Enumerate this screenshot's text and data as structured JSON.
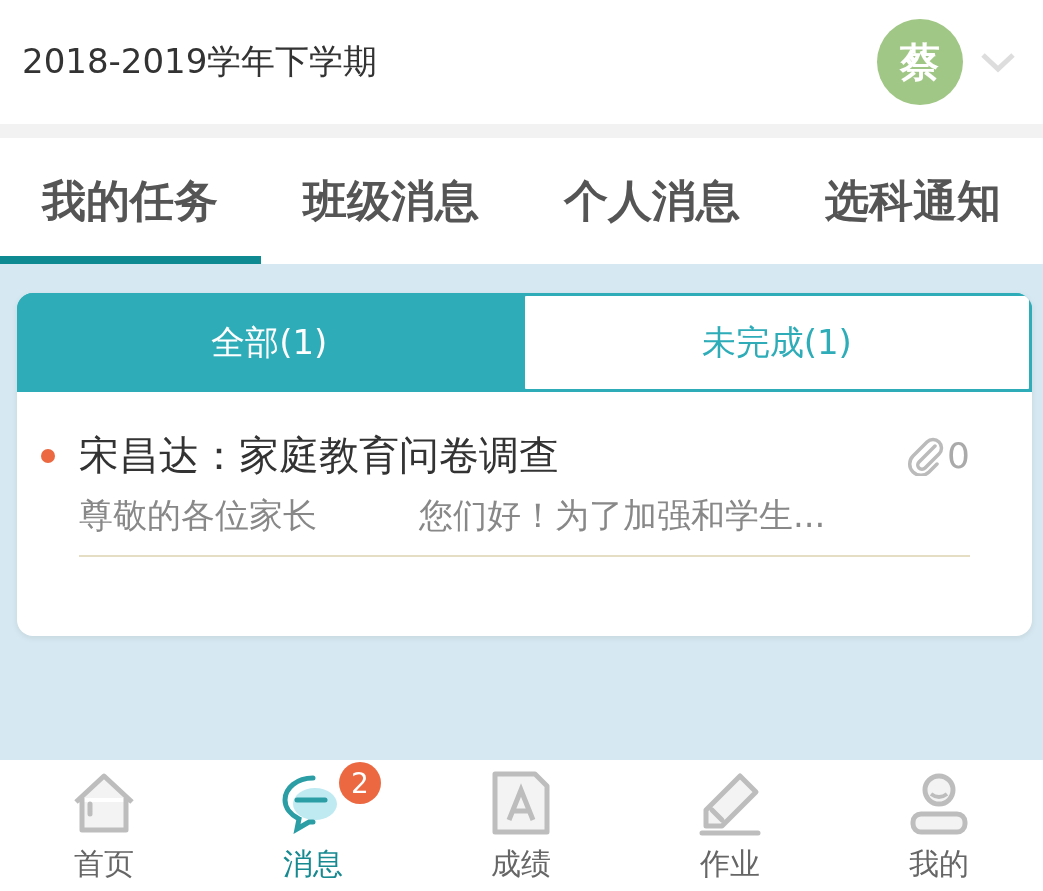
{
  "header": {
    "term": "2018-2019学年下学期",
    "avatar": "蔡"
  },
  "tabs": [
    {
      "label": "我的任务",
      "selected": true
    },
    {
      "label": "班级消息",
      "selected": false
    },
    {
      "label": "个人消息",
      "selected": false
    },
    {
      "label": "选科通知",
      "selected": false
    }
  ],
  "filters": [
    {
      "label": "全部(1)",
      "selected": true
    },
    {
      "label": "未完成(1)",
      "selected": false
    }
  ],
  "tasks": [
    {
      "title": "宋昌达：家庭教育问卷调查",
      "unread": true,
      "attachments": "0",
      "preview": "尊敬的各位家长　　　您们好！为了加强和学生..."
    }
  ],
  "nav": [
    {
      "kind": "home",
      "label": "首页",
      "selected": false
    },
    {
      "kind": "message",
      "label": "消息",
      "selected": true,
      "badge": "2"
    },
    {
      "kind": "grade",
      "label": "成绩",
      "selected": false
    },
    {
      "kind": "homework",
      "label": "作业",
      "selected": false
    },
    {
      "kind": "profile",
      "label": "我的",
      "selected": false
    }
  ]
}
